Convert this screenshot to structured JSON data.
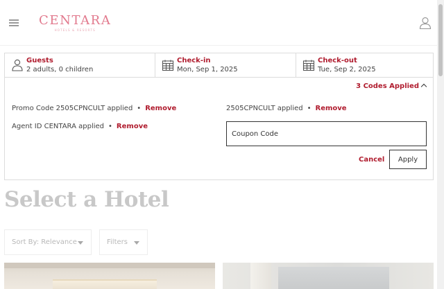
{
  "header": {
    "logo_text": "CENTARA",
    "logo_subtext": "HOTELS & RESORTS"
  },
  "booking": {
    "guests": {
      "label": "Guests",
      "value": "2 adults, 0 children"
    },
    "checkin": {
      "label": "Check-in",
      "value": "Mon, Sep 1, 2025"
    },
    "checkout": {
      "label": "Check-out",
      "value": "Tue, Sep 2, 2025"
    },
    "codes_toggle": "3 Codes Applied",
    "applied_codes": [
      {
        "text": "Promo Code 2505CPNCULT applied",
        "remove": "Remove"
      },
      {
        "text": "Agent ID CENTARA applied",
        "remove": "Remove"
      },
      {
        "text": "2505CPNCULT applied",
        "remove": "Remove"
      }
    ],
    "coupon_placeholder": "Coupon Code",
    "cancel_label": "Cancel",
    "apply_label": "Apply"
  },
  "main": {
    "title": "Select a Hotel",
    "sort_label": "Sort By: Relevance",
    "filters_label": "Filters"
  },
  "colors": {
    "accent": "#b01c2e",
    "brand": "#e27a8e"
  }
}
